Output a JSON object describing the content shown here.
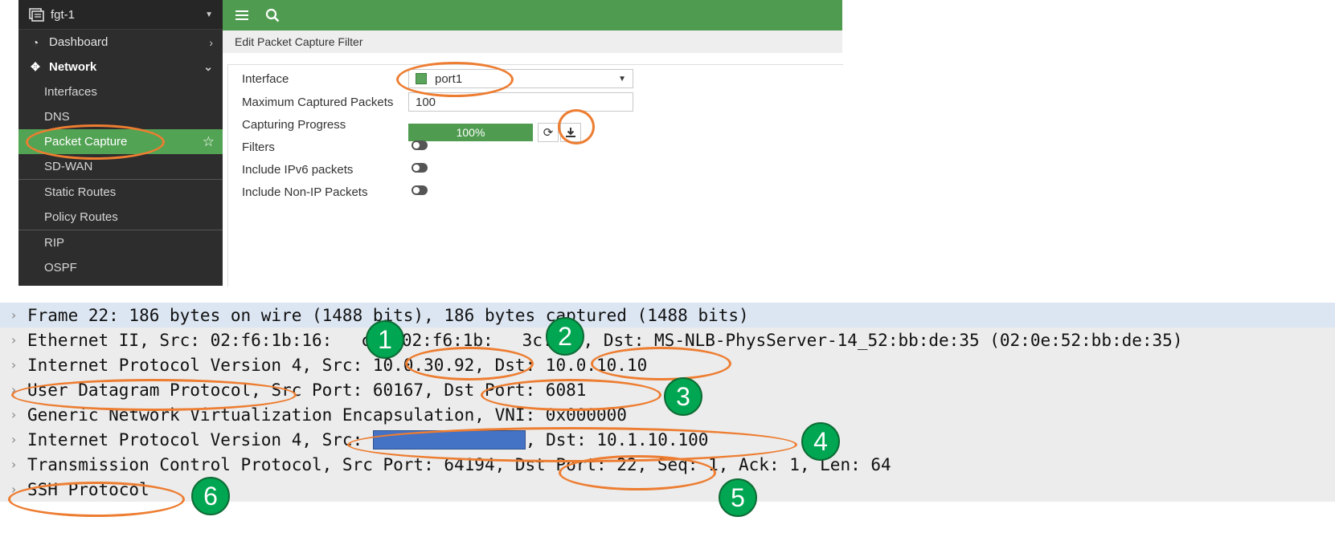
{
  "sidebar": {
    "device": "fgt-1",
    "items": [
      {
        "label": "Dashboard"
      },
      {
        "label": "Network"
      }
    ],
    "network_children": [
      "Interfaces",
      "DNS",
      "Packet Capture",
      "SD-WAN",
      "Static Routes",
      "Policy Routes",
      "RIP",
      "OSPF"
    ],
    "active": "Packet Capture"
  },
  "breadcrumb": "Edit Packet Capture Filter",
  "form": {
    "interface_label": "Interface",
    "interface_value": "port1",
    "max_packets_label": "Maximum Captured Packets",
    "max_packets_value": "100",
    "progress_label": "Capturing Progress",
    "progress_text": "100%",
    "progress_value": 1.0,
    "filters_label": "Filters",
    "ipv6_label": "Include IPv6 packets",
    "nonip_label": "Include Non-IP Packets"
  },
  "packet_details": {
    "rows": [
      "Frame 22: 186 bytes on wire (1488 bits), 186 bytes captured (1488 bits)",
      "Ethernet II, Src: 02:f6:1b:16:",
      "Internet Protocol Version 4, Src: 10.0.30.92, Dst: 10.0.10.10",
      "User Datagram Protocol, Src Port: 60167, Dst Port: 6081",
      "Generic Network Virtualization Encapsulation, VNI: 0x000000",
      "Internet Protocol Version 4, Src: ",
      "Transmission Control Protocol, Src Port: 64194, Dst Port: 22, Seq: 1, Ack: 1, Len: 64",
      "SSH Protocol"
    ],
    "eth_tail_a": "c5 (02:f6:1b:",
    "eth_tail_b": "3c:c5), Dst: MS-NLB-PhysServer-14_52:bb:de:35 (02:0e:52:bb:de:35)",
    "ip_inner_tail": ", Dst: 10.1.10.100"
  },
  "annotations": {
    "badges": [
      "1",
      "2",
      "3",
      "4",
      "5",
      "6"
    ]
  },
  "colors": {
    "accent_green": "#4f9c50",
    "annotation_orange": "#ed7d31",
    "badge_green": "#00a651",
    "redaction_blue": "#4472c4"
  }
}
